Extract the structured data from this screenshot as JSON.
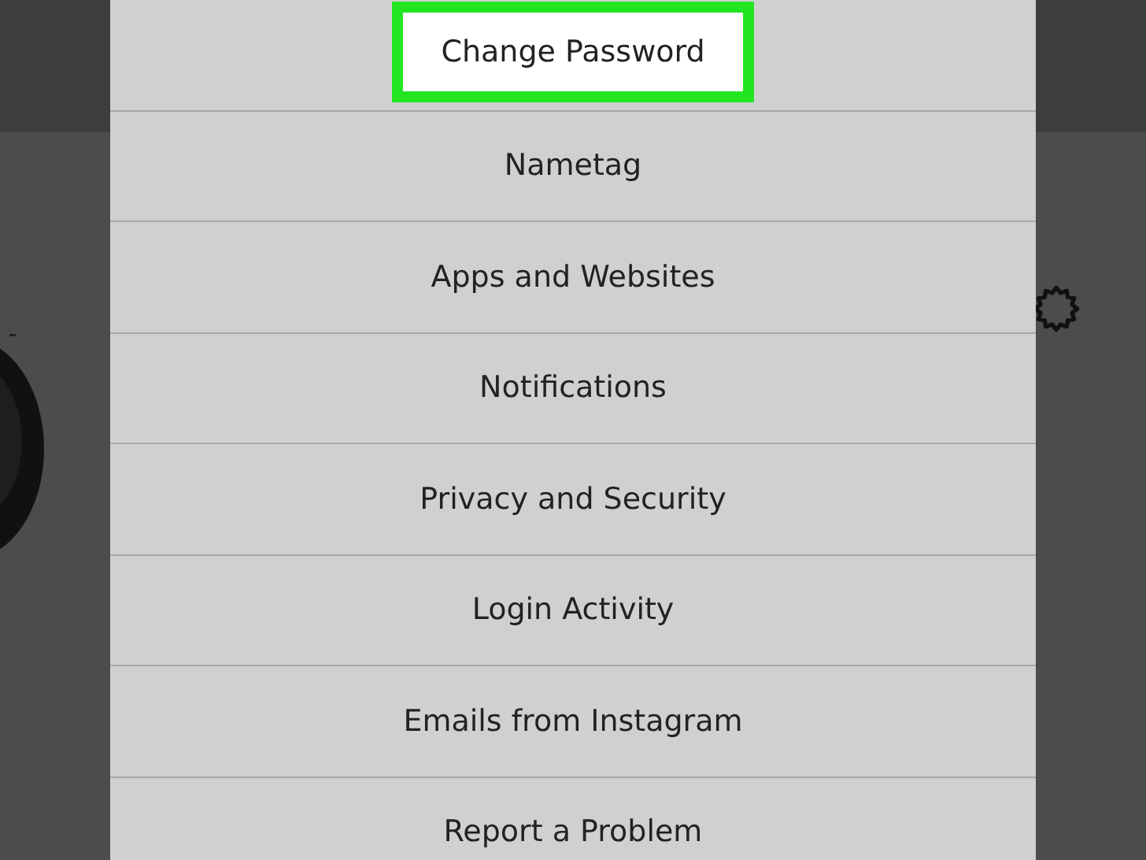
{
  "menu": {
    "items": [
      {
        "label": "Change Password",
        "highlighted": true
      },
      {
        "label": "Nametag",
        "highlighted": false
      },
      {
        "label": "Apps and Websites",
        "highlighted": false
      },
      {
        "label": "Notifications",
        "highlighted": false
      },
      {
        "label": "Privacy and Security",
        "highlighted": false
      },
      {
        "label": "Login Activity",
        "highlighted": false
      },
      {
        "label": "Emails from Instagram",
        "highlighted": false
      },
      {
        "label": "Report a Problem",
        "highlighted": false
      }
    ]
  }
}
